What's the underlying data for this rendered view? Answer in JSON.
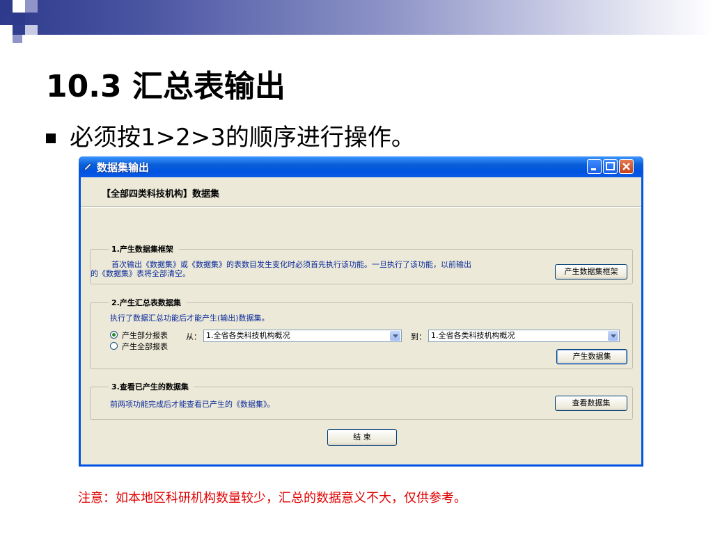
{
  "slide": {
    "title": "10.3 汇总表输出",
    "bullet": "必须按1>2>3的顺序进行操作。",
    "note": "注意：如本地区科研机构数量较少，汇总的数据意义不大，仅供参考。"
  },
  "window": {
    "title": "数据集输出",
    "dataset_title": "【全部四类科技机构】数据集",
    "group1": {
      "legend": "1.产生数据集框架",
      "text_line1": "首次输出《数据集》或《数据集》的表数目发生变化时必须首先执行该功能。一旦执行了该功能，以前输出",
      "text_line2": "的《数据集》表将全部清空。",
      "button": "产生数据集框架"
    },
    "group2": {
      "legend": "2.产生汇总表数据集",
      "text": "执行了数据汇总功能后才能产生(输出)数据集。",
      "radio_partial": "产生部分报表",
      "radio_all": "产生全部报表",
      "from_label": "从：",
      "from_value": "1.全省各类科技机构概况",
      "to_label": "到：",
      "to_value": "1.全省各类科技机构概况",
      "button": "产生数据集"
    },
    "group3": {
      "legend": "3.查看已产生的数据集",
      "text": "前两项功能完成后才能查看已产生的《数据集》。",
      "button": "查看数据集"
    },
    "end_button": "结  束"
  },
  "colors": {
    "titlebar": "#0054e3",
    "window_bg": "#ece9d8",
    "group_text": "#0a2a9a",
    "note": "#e00000"
  },
  "icons": [
    "app-pen-icon",
    "minimize-icon",
    "maximize-icon",
    "close-icon",
    "chevron-down-icon"
  ]
}
